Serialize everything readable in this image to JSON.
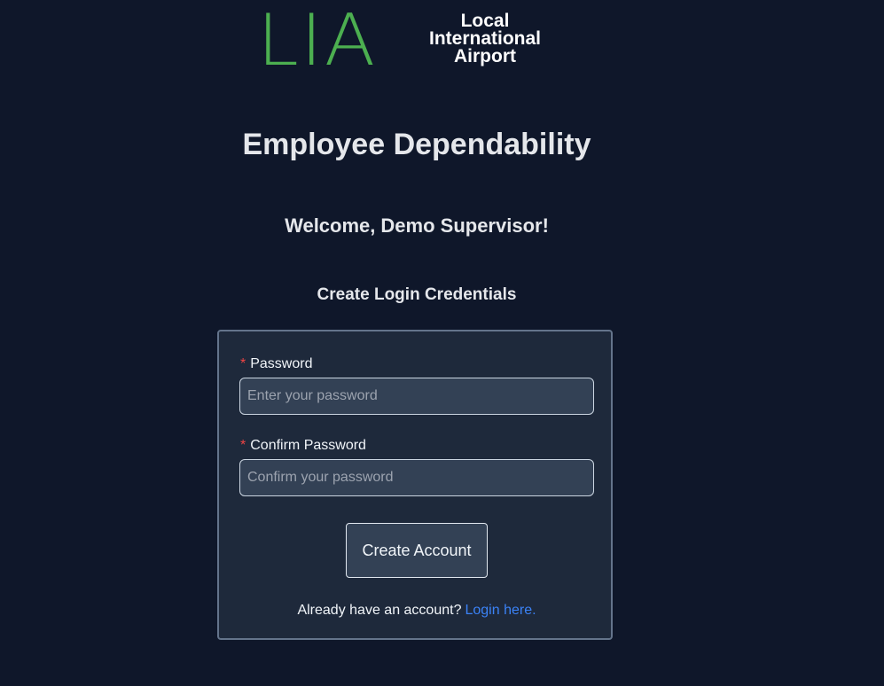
{
  "logo": {
    "mark": "LIA",
    "line1": "Local",
    "line2": "International",
    "line3": "Airport"
  },
  "title": "Employee Dependability",
  "welcome": {
    "prefix": "Welcome,",
    "name": "Demo Supervisor!"
  },
  "subtitle": "Create Login Credentials",
  "form": {
    "required_marker": "*",
    "password_label": "Password",
    "password_placeholder": "Enter your password",
    "password_value": "",
    "confirm_label": "Confirm Password",
    "confirm_placeholder": "Confirm your password",
    "confirm_value": "",
    "submit_label": "Create Account",
    "footer_text": "Already have an account?",
    "footer_link": "Login here."
  },
  "colors": {
    "background": "#0f172a",
    "card": "#1e293b",
    "logo_green": "#4caf50",
    "link": "#3b82f6",
    "required": "#ef4444"
  }
}
